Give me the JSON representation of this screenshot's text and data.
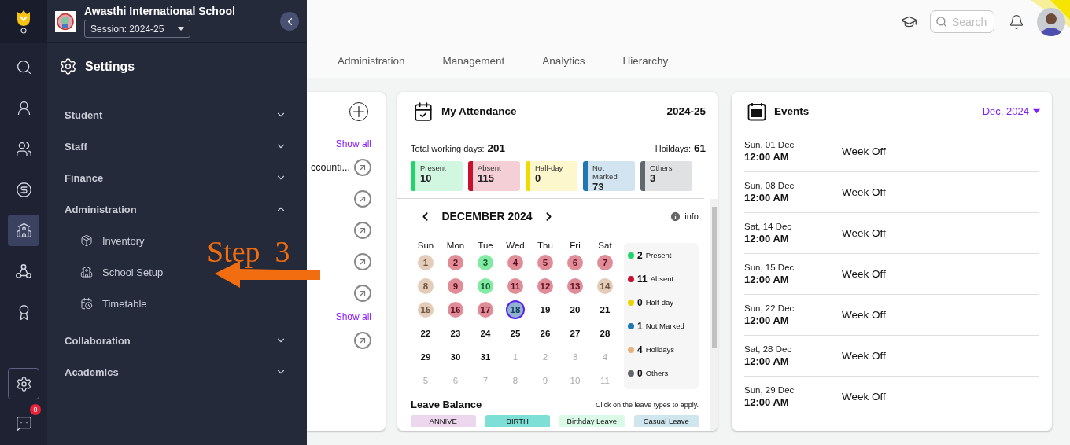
{
  "rail": {
    "top": [
      {
        "selected": false,
        "open": false
      },
      {
        "selected": false,
        "open": false
      },
      {
        "selected": false,
        "open": false
      },
      {
        "selected": false,
        "open": false
      },
      {
        "selected": true,
        "open": false
      },
      {
        "selected": false,
        "open": false
      },
      {
        "selected": false,
        "open": false
      }
    ],
    "bottom": [
      {
        "selected": false,
        "open": true
      },
      {
        "selected": false,
        "open": false,
        "badge": "0"
      }
    ]
  },
  "panel": {
    "school_name": "Awasthi International School",
    "session": "Session: 2024-25",
    "heading": "Settings",
    "menu": [
      {
        "label": "Student",
        "expanded": false
      },
      {
        "label": "Staff",
        "expanded": false
      },
      {
        "label": "Finance",
        "expanded": false
      },
      {
        "label": "Administration",
        "expanded": true,
        "children": [
          {
            "label": "Inventory"
          },
          {
            "label": "School Setup"
          },
          {
            "label": "Timetable"
          }
        ]
      },
      {
        "label": "Collaboration",
        "expanded": false
      },
      {
        "label": "Academics",
        "expanded": false
      }
    ]
  },
  "annotation": {
    "text": "Step  3"
  },
  "header": {
    "search_placeholder": "Search"
  },
  "tabs": [
    "Administration",
    "Management",
    "Analytics",
    "Hierarchy"
  ],
  "partial_card": {
    "items": [
      {
        "kind": "link",
        "label": "Show all"
      },
      {
        "kind": "row",
        "text": "ccounti..."
      },
      {
        "kind": "row"
      },
      {
        "kind": "row"
      },
      {
        "kind": "row"
      },
      {
        "kind": "row"
      },
      {
        "kind": "link",
        "label": "Show all"
      },
      {
        "kind": "row"
      }
    ]
  },
  "attendance": {
    "title": "My Attendance",
    "year": "2024-25",
    "working_label": "Total working days:",
    "working_value": "201",
    "holidays_label": "Hoildays:",
    "holidays_value": "61",
    "tiles": [
      {
        "label": "Present",
        "value": "10",
        "color": "#1ed66a"
      },
      {
        "label": "Absent",
        "value": "115",
        "color": "#c8102e"
      },
      {
        "label": "Half-day",
        "value": "0",
        "color": "#f2d900"
      },
      {
        "label": "Not Marked",
        "value": "73",
        "color": "#1f77b4"
      },
      {
        "label": "Others",
        "value": "3",
        "color": "#62676d"
      }
    ],
    "month": "DECEMBER 2024",
    "info": "info",
    "weekdays": [
      "Sun",
      "Mon",
      "Tue",
      "Wed",
      "Thu",
      "Fri",
      "Sat"
    ],
    "weeks": [
      [
        {
          "day": "1",
          "kind": "holiday",
          "selected": false
        },
        {
          "day": "2",
          "kind": "absent",
          "selected": false
        },
        {
          "day": "3",
          "kind": "present",
          "selected": false
        },
        {
          "day": "4",
          "kind": "absent",
          "selected": false
        },
        {
          "day": "5",
          "kind": "absent",
          "selected": false
        },
        {
          "day": "6",
          "kind": "absent",
          "selected": false
        },
        {
          "day": "7",
          "kind": "absent",
          "selected": false
        }
      ],
      [
        {
          "day": "8",
          "kind": "holiday",
          "selected": false
        },
        {
          "day": "9",
          "kind": "absent",
          "selected": false
        },
        {
          "day": "10",
          "kind": "present",
          "selected": false
        },
        {
          "day": "11",
          "kind": "absent",
          "selected": false
        },
        {
          "day": "12",
          "kind": "absent",
          "selected": false
        },
        {
          "day": "13",
          "kind": "absent",
          "selected": false
        },
        {
          "day": "14",
          "kind": "holiday",
          "selected": false
        }
      ],
      [
        {
          "day": "15",
          "kind": "holiday",
          "selected": false
        },
        {
          "day": "16",
          "kind": "absent",
          "selected": false
        },
        {
          "day": "17",
          "kind": "absent",
          "selected": false
        },
        {
          "day": "18",
          "kind": "unmarked",
          "selected": true
        },
        {
          "day": "19",
          "kind": "plain",
          "selected": false
        },
        {
          "day": "20",
          "kind": "plain",
          "selected": false
        },
        {
          "day": "21",
          "kind": "plain",
          "selected": false
        }
      ],
      [
        {
          "day": "22",
          "kind": "plain",
          "selected": false
        },
        {
          "day": "23",
          "kind": "plain",
          "selected": false
        },
        {
          "day": "24",
          "kind": "plain",
          "selected": false
        },
        {
          "day": "25",
          "kind": "plain",
          "selected": false
        },
        {
          "day": "26",
          "kind": "plain",
          "selected": false
        },
        {
          "day": "27",
          "kind": "plain",
          "selected": false
        },
        {
          "day": "28",
          "kind": "plain",
          "selected": false
        }
      ],
      [
        {
          "day": "29",
          "kind": "plain",
          "selected": false
        },
        {
          "day": "30",
          "kind": "plain",
          "selected": false
        },
        {
          "day": "31",
          "kind": "plain",
          "selected": false
        },
        {
          "day": "1",
          "kind": "outside",
          "selected": false
        },
        {
          "day": "2",
          "kind": "outside",
          "selected": false
        },
        {
          "day": "3",
          "kind": "outside",
          "selected": false
        },
        {
          "day": "4",
          "kind": "outside",
          "selected": false
        }
      ],
      [
        {
          "day": "5",
          "kind": "outside",
          "selected": false
        },
        {
          "day": "6",
          "kind": "outside",
          "selected": false
        },
        {
          "day": "7",
          "kind": "outside",
          "selected": false
        },
        {
          "day": "8",
          "kind": "outside",
          "selected": false
        },
        {
          "day": "9",
          "kind": "outside",
          "selected": false
        },
        {
          "day": "10",
          "kind": "outside",
          "selected": false
        },
        {
          "day": "11",
          "kind": "outside",
          "selected": false
        }
      ]
    ],
    "legend": [
      {
        "count": "2",
        "label": "Present",
        "color": "#1ed66a"
      },
      {
        "count": "11",
        "label": "Absent",
        "color": "#c8102e"
      },
      {
        "count": "0",
        "label": "Half-day",
        "color": "#ecd400"
      },
      {
        "count": "1",
        "label": "Not Marked",
        "color": "#1f77b4"
      },
      {
        "count": "4",
        "label": "Holidays",
        "color": "#e8b07f"
      },
      {
        "count": "0",
        "label": "Others",
        "color": "#62676d"
      }
    ],
    "leave_title": "Leave Balance",
    "leave_hint": "Click on the leave types to apply.",
    "leaves": [
      {
        "label": "ANNIVE",
        "color": "#ecd7ef"
      },
      {
        "label": "BIRTH",
        "color": "#7ddfd6"
      },
      {
        "label": "Birthday Leave",
        "color": "#daf9e6"
      },
      {
        "label": "Casual Leave",
        "color": "#cfe6ee"
      }
    ]
  },
  "events": {
    "title": "Events",
    "month": "Dec, 2024",
    "rows": [
      {
        "date": "Sun, 01 Dec",
        "time": "12:00 AM",
        "title": "Week Off"
      },
      {
        "date": "Sun, 08 Dec",
        "time": "12:00 AM",
        "title": "Week Off"
      },
      {
        "date": "Sat, 14 Dec",
        "time": "12:00 AM",
        "title": "Week Off"
      },
      {
        "date": "Sun, 15 Dec",
        "time": "12:00 AM",
        "title": "Week Off"
      },
      {
        "date": "Sun, 22 Dec",
        "time": "12:00 AM",
        "title": "Week Off"
      },
      {
        "date": "Sat, 28 Dec",
        "time": "12:00 AM",
        "title": "Week Off"
      },
      {
        "date": "Sun, 29 Dec",
        "time": "12:00 AM",
        "title": "Week Off"
      }
    ]
  }
}
